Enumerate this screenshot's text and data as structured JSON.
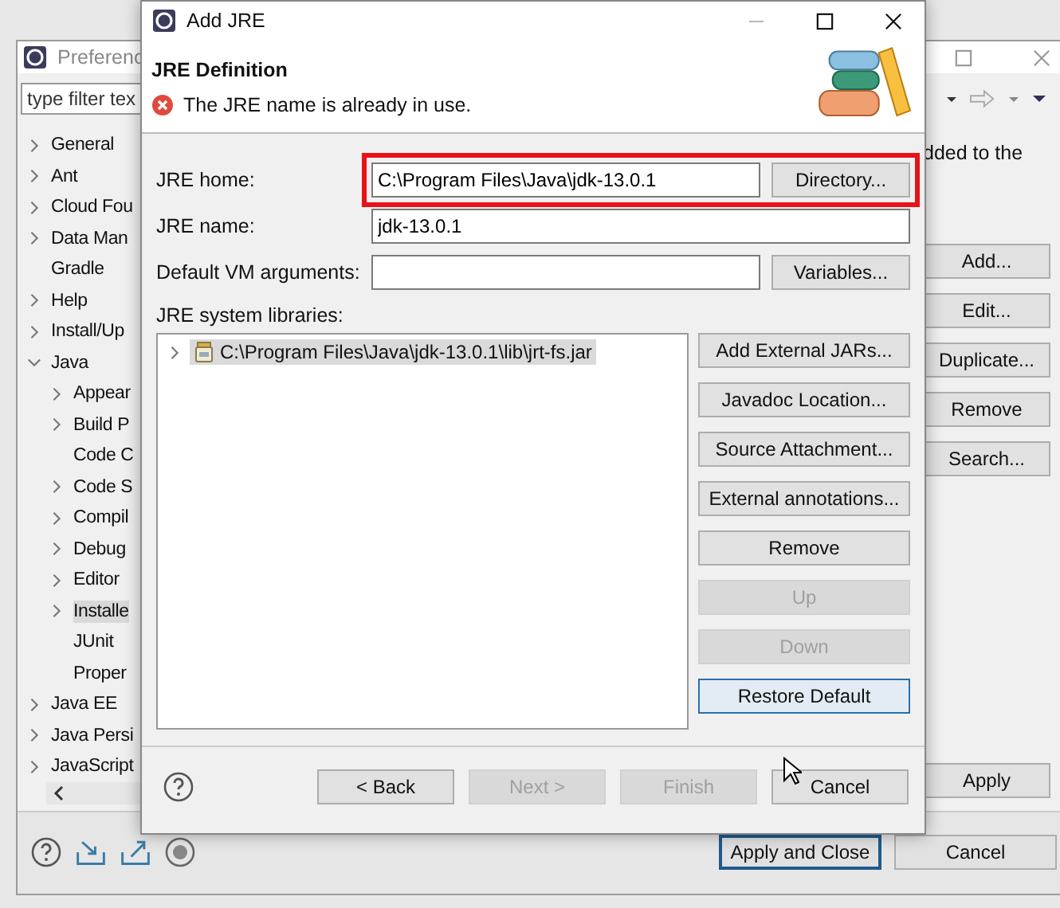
{
  "preferences_window": {
    "title": "Preferenc",
    "filter": {
      "placeholder": "type filter tex"
    },
    "tree": [
      {
        "label": "General",
        "kind": "folder",
        "expanded": false,
        "selected": false
      },
      {
        "label": "Ant",
        "kind": "folder",
        "expanded": false,
        "selected": false
      },
      {
        "label": "Cloud Fou",
        "kind": "folder",
        "expanded": false,
        "selected": false
      },
      {
        "label": "Data Man",
        "kind": "folder",
        "expanded": false,
        "selected": false
      },
      {
        "label": "Gradle",
        "kind": "leaf",
        "selected": false
      },
      {
        "label": "Help",
        "kind": "folder",
        "expanded": false,
        "selected": false
      },
      {
        "label": "Install/Up",
        "kind": "folder",
        "expanded": false,
        "selected": false
      },
      {
        "label": "Java",
        "kind": "folder",
        "expanded": true,
        "selected": false,
        "children": [
          {
            "label": "Appear",
            "kind": "folder",
            "expanded": false,
            "selected": false
          },
          {
            "label": "Build P",
            "kind": "folder",
            "expanded": false,
            "selected": false
          },
          {
            "label": "Code C",
            "kind": "leaf",
            "selected": false
          },
          {
            "label": "Code S",
            "kind": "folder",
            "expanded": false,
            "selected": false
          },
          {
            "label": "Compil",
            "kind": "folder",
            "expanded": false,
            "selected": false
          },
          {
            "label": "Debug",
            "kind": "folder",
            "expanded": false,
            "selected": false
          },
          {
            "label": "Editor",
            "kind": "folder",
            "expanded": false,
            "selected": false
          },
          {
            "label": "Installe",
            "kind": "folder",
            "expanded": false,
            "selected": true
          },
          {
            "label": "JUnit",
            "kind": "leaf",
            "selected": false
          },
          {
            "label": "Proper",
            "kind": "leaf",
            "selected": false
          }
        ]
      },
      {
        "label": "Java EE",
        "kind": "folder",
        "expanded": false,
        "selected": false
      },
      {
        "label": "Java Persi",
        "kind": "folder",
        "expanded": false,
        "selected": false
      },
      {
        "label": "JavaScript",
        "kind": "folder",
        "expanded": false,
        "selected": false
      }
    ],
    "description": "dded to the",
    "side_buttons": [
      "Add...",
      "Edit...",
      "Duplicate...",
      "Remove",
      "Search..."
    ],
    "apply": "Apply",
    "footer_buttons": [
      {
        "label": "Apply and Close",
        "focused": true
      },
      {
        "label": "Cancel",
        "focused": false
      }
    ]
  },
  "dialog": {
    "title": "Add JRE",
    "heading": "JRE Definition",
    "message": {
      "kind": "error",
      "text": "The JRE name is already in use."
    },
    "fields": [
      {
        "label": "JRE home:",
        "value": "C:\\Program Files\\Java\\jdk-13.0.1",
        "button": "Directory...",
        "highlighted": true
      },
      {
        "label": "JRE name:",
        "value": "jdk-13.0.1"
      },
      {
        "label": "Default VM arguments:",
        "button": "Variables..."
      }
    ],
    "libraries_label": "JRE system libraries:",
    "libraries": [
      {
        "label": "C:\\Program Files\\Java\\jdk-13.0.1\\lib\\jrt-fs.jar",
        "expanded": false,
        "selected": true
      }
    ],
    "library_buttons": [
      {
        "label": "Add External JARs...",
        "disabled": false,
        "focused": false
      },
      {
        "label": "Javadoc Location...",
        "disabled": false,
        "focused": false
      },
      {
        "label": "Source Attachment...",
        "disabled": false,
        "focused": false
      },
      {
        "label": "External annotations...",
        "disabled": false,
        "focused": false
      },
      {
        "label": "Remove",
        "disabled": false,
        "focused": false
      },
      {
        "label": "Up",
        "disabled": true,
        "focused": false
      },
      {
        "label": "Down",
        "disabled": true,
        "focused": false
      },
      {
        "label": "Restore Default",
        "disabled": false,
        "focused": true
      }
    ],
    "nav_buttons": [
      {
        "label": "< Back",
        "disabled": false
      },
      {
        "label": "Next >",
        "disabled": true
      },
      {
        "label": "Finish",
        "disabled": true
      },
      {
        "label": "Cancel",
        "disabled": false
      }
    ]
  }
}
